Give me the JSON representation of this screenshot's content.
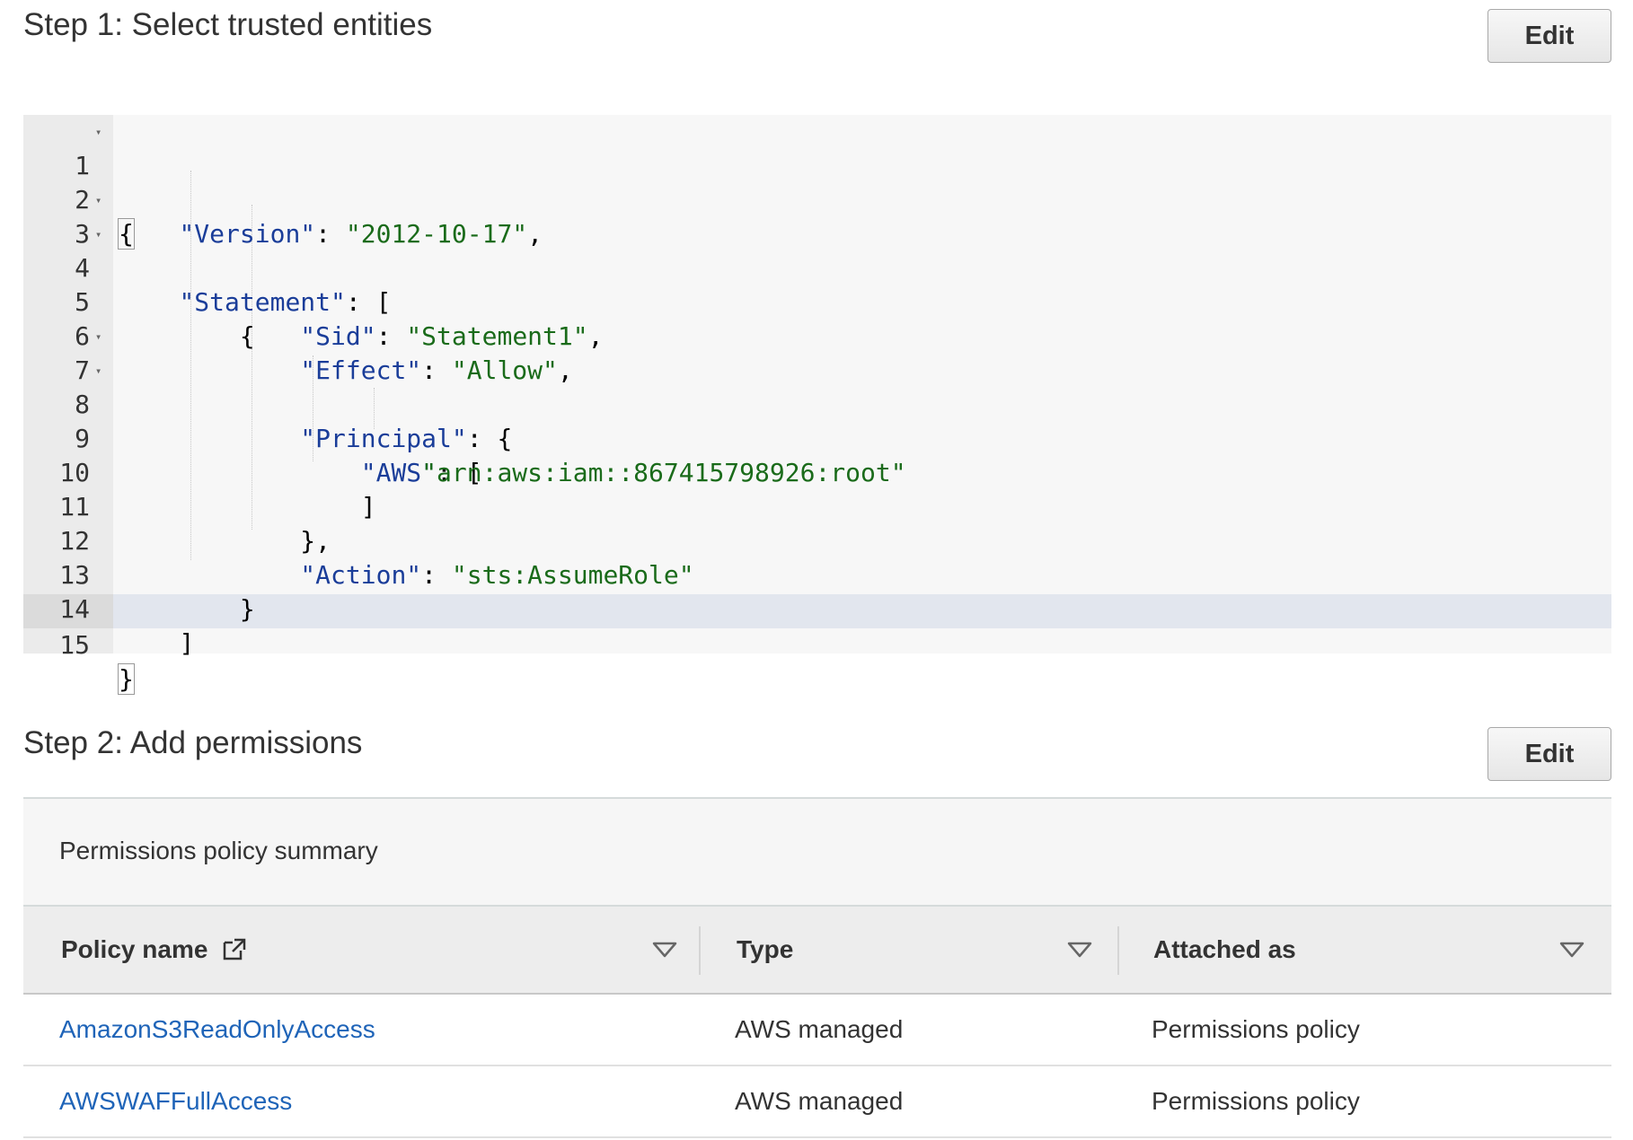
{
  "step1": {
    "title": "Step 1: Select trusted entities",
    "edit_label": "Edit"
  },
  "editor": {
    "line_numbers": [
      "1",
      "2",
      "3",
      "4",
      "5",
      "6",
      "7",
      "8",
      "9",
      "10",
      "11",
      "12",
      "13",
      "14",
      "15"
    ],
    "tokens": {
      "version_key": "\"Version\"",
      "version_val": "\"2012-10-17\"",
      "statement_key": "\"Statement\"",
      "sid_key": "\"Sid\"",
      "sid_val": "\"Statement1\"",
      "effect_key": "\"Effect\"",
      "effect_val": "\"Allow\"",
      "principal_key": "\"Principal\"",
      "aws_key": "\"AWS\"",
      "arn_val": "\"arn:aws:iam::867415798926:root\"",
      "action_key": "\"Action\"",
      "action_val": "\"sts:AssumeRole\""
    }
  },
  "step2": {
    "title": "Step 2: Add permissions",
    "edit_label": "Edit",
    "summary_title": "Permissions policy summary",
    "columns": [
      "Policy name",
      "Type",
      "Attached as"
    ],
    "rows": [
      {
        "name": "AmazonS3ReadOnlyAccess",
        "type": "AWS managed",
        "attached": "Permissions policy"
      },
      {
        "name": "AWSWAFFullAccess",
        "type": "AWS managed",
        "attached": "Permissions policy"
      }
    ]
  },
  "colors": {
    "link": "#1f64b8",
    "json_key": "#1a3d99",
    "json_string": "#1a6b1a"
  },
  "icons": {
    "fold": "fold-arrow-icon",
    "external_link": "external-link-icon",
    "sort": "sort-caret-icon"
  }
}
